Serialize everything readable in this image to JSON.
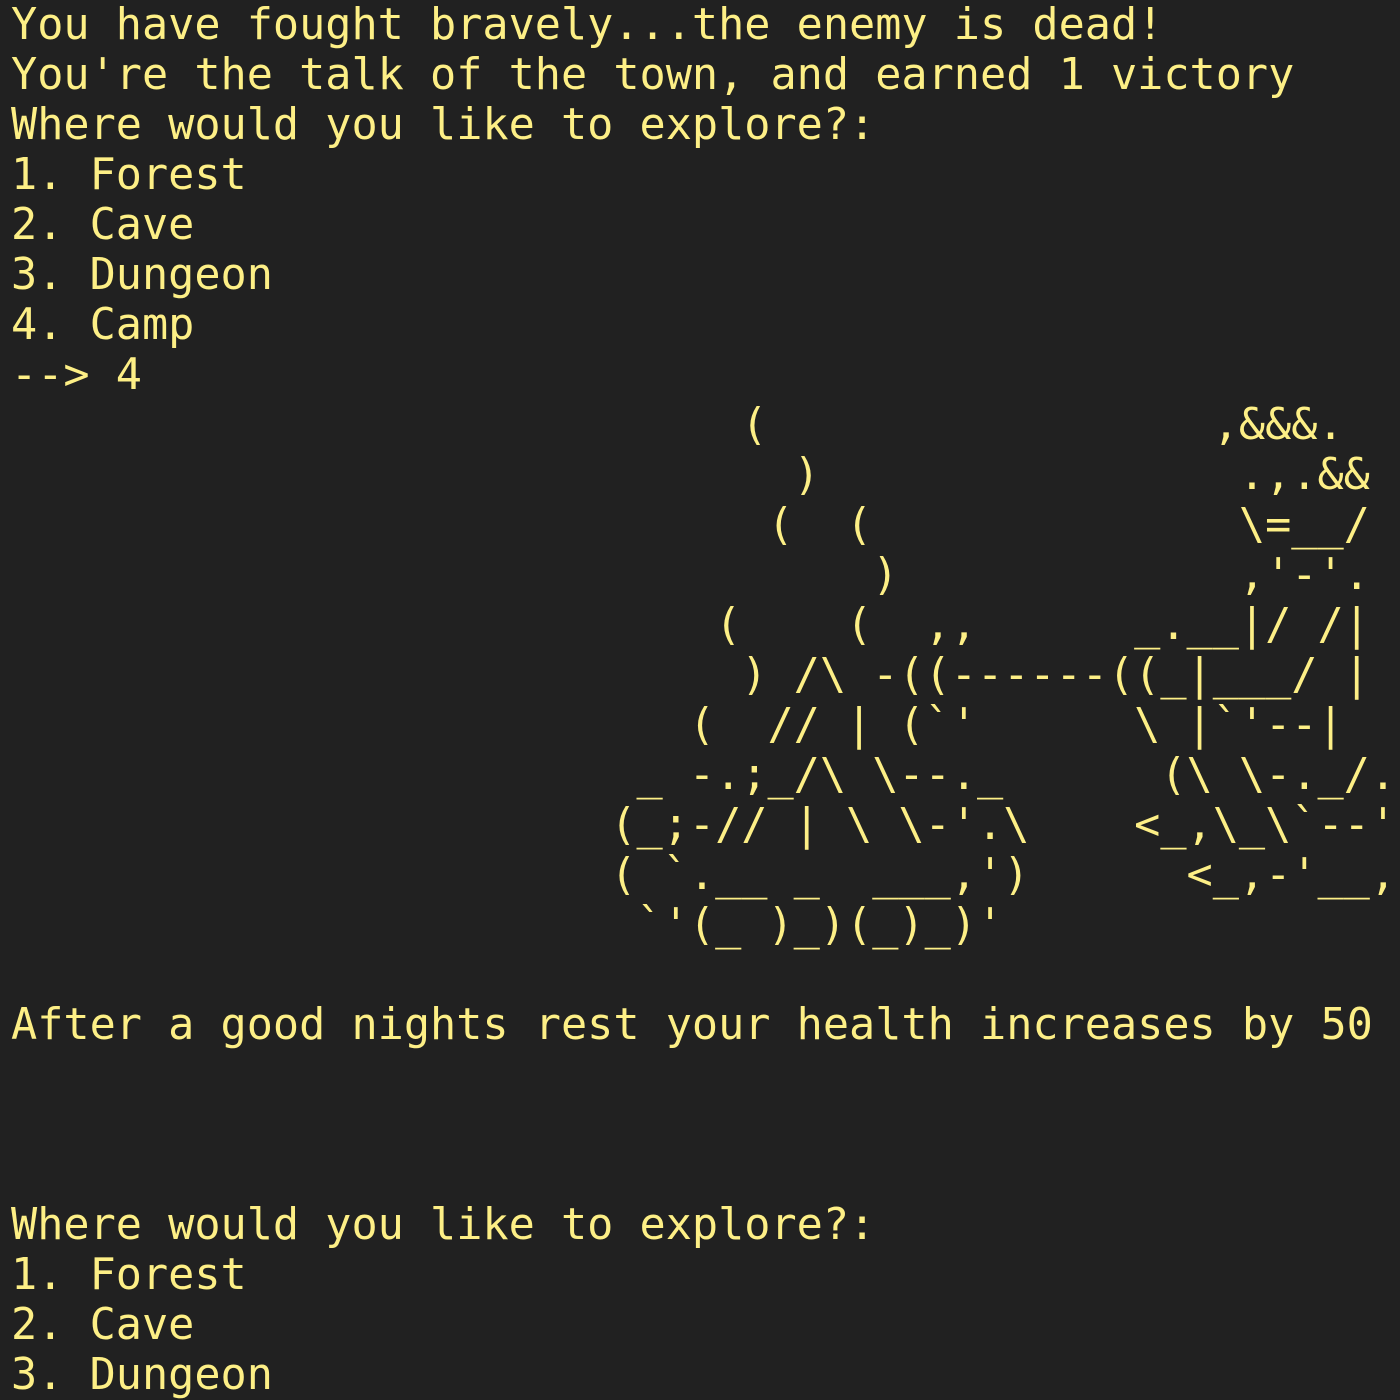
{
  "terminal": {
    "text_color": "#fdef86",
    "background_color": "#212121",
    "intro": [
      "You have fought bravely...the enemy is dead!",
      "You're the talk of the town, and earned 1 victory"
    ],
    "first_menu": {
      "prompt": "Where would you like to explore?:",
      "options": [
        "1. Forest",
        "2. Cave",
        "3. Dungeon",
        "4. Camp"
      ],
      "input": "--> 4"
    },
    "campfire_art": [
      "                            (                 ,&&&.",
      "                              )                .,.&&",
      "                             (  (              \\=__/",
      "                                 )             ,'-'.",
      "                           (    (  ,,      _.__|/ /|",
      "                            ) /\\ -((------((_|___/ |",
      "                          (  // | (`'      \\ |`'--|",
      "                        _ -.;_/\\ \\--._      (\\ \\-._/.",
      "                       (_;-// | \\ \\-'.\\    <_,\\_\\`--'|",
      "                       ( `.__ _  ___,')      <_,-'__,'",
      "                        `'(_ )_)(_)_)'"
    ],
    "rest_message": "After a good nights rest your health increases by 50",
    "second_menu": {
      "prompt": "Where would you like to explore?:",
      "options": [
        "1. Forest",
        "2. Cave",
        "3. Dungeon"
      ]
    }
  }
}
